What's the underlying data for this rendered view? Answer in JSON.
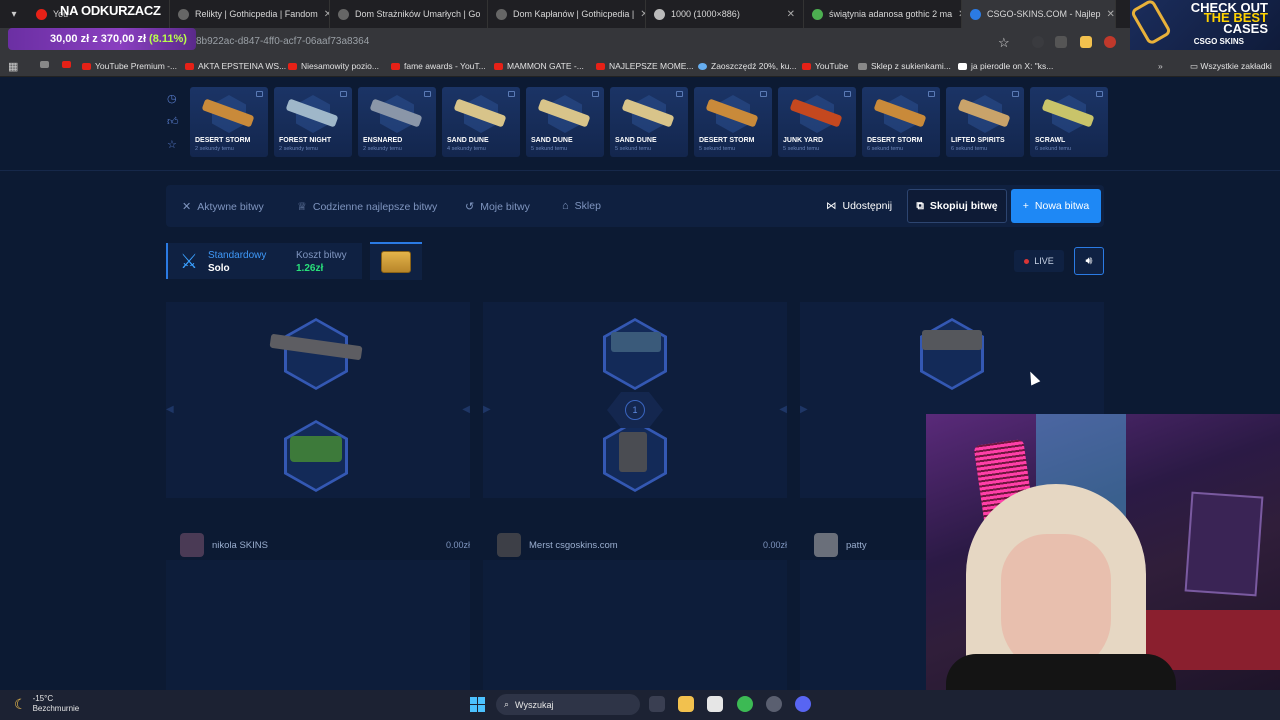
{
  "browser": {
    "tabs": [
      {
        "label": "You",
        "favicon_color": "#e62117"
      },
      {
        "label": "Relikty | Gothicpedia | Fandom",
        "favicon_color": "#888888"
      },
      {
        "label": "Dom Strażników Umarłych | Go",
        "favicon_color": "#888888"
      },
      {
        "label": "Dom Kapłanów | Gothicpedia |",
        "favicon_color": "#888888"
      },
      {
        "label": "1000 (1000×886)",
        "favicon_color": "#cccccc"
      },
      {
        "label": "świątynia adanosa gothic 2 ma",
        "favicon_color": "#4caf50"
      },
      {
        "label": "CSGO-SKINS.COM - Najlep",
        "favicon_color": "#2b7be4"
      }
    ],
    "promo_text": "NA ODKURZACZ",
    "price_banner": {
      "amount": "30,00 zł",
      "of": "z 370,00 zł",
      "pct": "(8.11%)"
    },
    "url": "8b922ac-d847-4ff0-acf7-06aaf73a8364",
    "bookmarks": [
      {
        "label": "YouTube Premium -...",
        "icon": "youtube-icon"
      },
      {
        "label": "AKTA EPSTEINA WS...",
        "icon": "youtube-icon"
      },
      {
        "label": "Niesamowity pozio...",
        "icon": "youtube-icon"
      },
      {
        "label": "fame awards - YouT...",
        "icon": "youtube-icon"
      },
      {
        "label": "MAMMON GATE -...",
        "icon": "youtube-icon"
      },
      {
        "label": "NAJLEPSZE MOME...",
        "icon": "youtube-icon"
      },
      {
        "label": "Zaoszczędź 20%, ku...",
        "icon": "steam-icon"
      },
      {
        "label": "YouTube",
        "icon": "youtube-icon"
      },
      {
        "label": "Sklep z sukienkami...",
        "icon": "page-icon"
      },
      {
        "label": "ja pierodle on X: \"ks...",
        "icon": "x-icon"
      }
    ],
    "all_bookmarks": "Wszystkie zakładki"
  },
  "ad": {
    "line1": "CHECK OUT",
    "line2": "THE BEST",
    "line3": "CASES",
    "brand": "CSGO SKINS"
  },
  "recent_drops": [
    {
      "name": "DESERT STORM",
      "ago": "2 sekundy temu",
      "color": "#c98a3a"
    },
    {
      "name": "FOREST NIGHT",
      "ago": "2 sekundy temu",
      "color": "#9fb7c9"
    },
    {
      "name": "ENSNARED",
      "ago": "2 sekundy temu",
      "color": "#8a96a8"
    },
    {
      "name": "SAND DUNE",
      "ago": "4 sekundy temu",
      "color": "#d8c48a"
    },
    {
      "name": "SAND DUNE",
      "ago": "5 sekund temu",
      "color": "#d8c48a"
    },
    {
      "name": "SAND DUNE",
      "ago": "5 sekund temu",
      "color": "#d8c48a"
    },
    {
      "name": "DESERT STORM",
      "ago": "5 sekund temu",
      "color": "#c98a3a"
    },
    {
      "name": "JUNK YARD",
      "ago": "5 sekund temu",
      "color": "#c4481f"
    },
    {
      "name": "DESERT STORM",
      "ago": "6 sekund temu",
      "color": "#c98a3a"
    },
    {
      "name": "LIFTED SPIRITS",
      "ago": "6 sekund temu",
      "color": "#c9a36a"
    },
    {
      "name": "SCRAWL",
      "ago": "6 sekund temu",
      "color": "#c9c46a"
    }
  ],
  "nav": {
    "active_battles": "Aktywne bitwy",
    "daily_best": "Codzienne najlepsze bitwy",
    "my_battles": "Moje bitwy",
    "shop": "Sklep",
    "share": "Udostępnij",
    "copy": "Skopiuj bitwę",
    "new": "Nowa bitwa"
  },
  "battle": {
    "mode_label": "Standardowy",
    "mode_value": "Solo",
    "cost_label": "Koszt bitwy",
    "cost_value": "1.26zł",
    "live": "LIVE",
    "round": "1"
  },
  "players": [
    {
      "name": "nikola SKINS",
      "value": "0.00zł"
    },
    {
      "name": "Merst csgoskins.com",
      "value": "0.00zł"
    },
    {
      "name": "patty",
      "value": ""
    }
  ],
  "taskbar": {
    "temp": "-15°C",
    "weather": "Bezchmurnie",
    "search": "Wyszukaj"
  },
  "colors": {
    "accent": "#1e88f5",
    "green": "#29e07a",
    "background": "#0c1a33"
  }
}
